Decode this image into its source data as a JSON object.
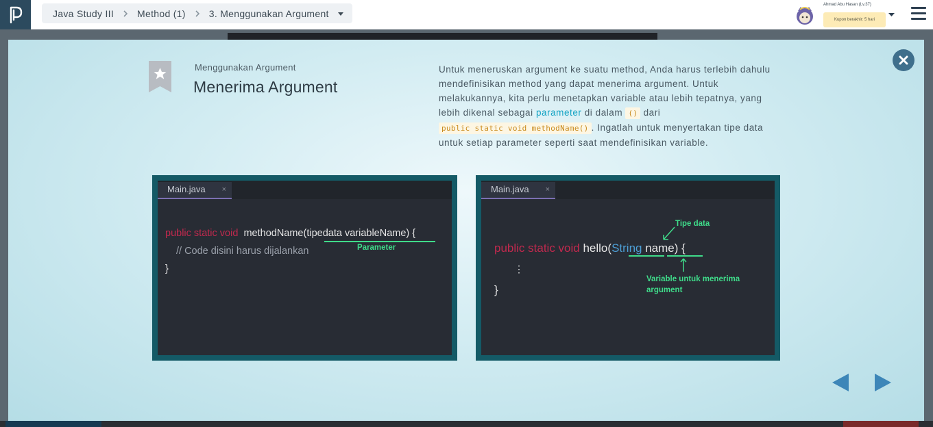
{
  "breadcrumb": {
    "course": "Java Study III",
    "section": "Method (1)",
    "lesson": "3. Menggunakan Argument"
  },
  "user": {
    "name": "Ahmad Abu Hasan (Lv.37)",
    "coupon": "Kupon berakhir: 5 hari"
  },
  "slide": {
    "subtitle": "Menggunakan Argument",
    "title": "Menerima Argument",
    "desc_1": "Untuk meneruskan argument ke suatu method, Anda harus terlebih dahulu mendefinisikan method yang dapat menerima argument. Untuk melakukannya, kita perlu menetapkan variable atau lebih tepatnya, yang lebih dikenal sebagai ",
    "desc_param": "parameter",
    "desc_2": " di dalam ",
    "desc_code1": "()",
    "desc_3": " dari ",
    "desc_code2": "public static void methodName()",
    "desc_4": ". Ingatlah untuk menyertakan tipe data untuk setiap parameter seperti saat mendefinisikan variable."
  },
  "editor_left": {
    "tab": "Main.java",
    "tab_close": "×",
    "kw": "public static void",
    "fn": "methodName(",
    "param": "tipedata variableName",
    "close": ") {",
    "comment": "// Code disini harus dijalankan",
    "brace": "}",
    "annotation": "Parameter"
  },
  "editor_right": {
    "tab": "Main.java",
    "tab_close": "×",
    "kw": "public static void",
    "fn": "hello(",
    "type": "String",
    "name": "name",
    "close": ") {",
    "dots": "⋮",
    "brace": "}",
    "annotation_type": "Tipe data",
    "annotation_var_1": "Variable untuk menerima",
    "annotation_var_2": "argument"
  },
  "colors": {
    "accent": "#13a3c4",
    "keyword": "#c2294e",
    "annotation": "#3fdc8a",
    "nav": "#3d86b8"
  }
}
